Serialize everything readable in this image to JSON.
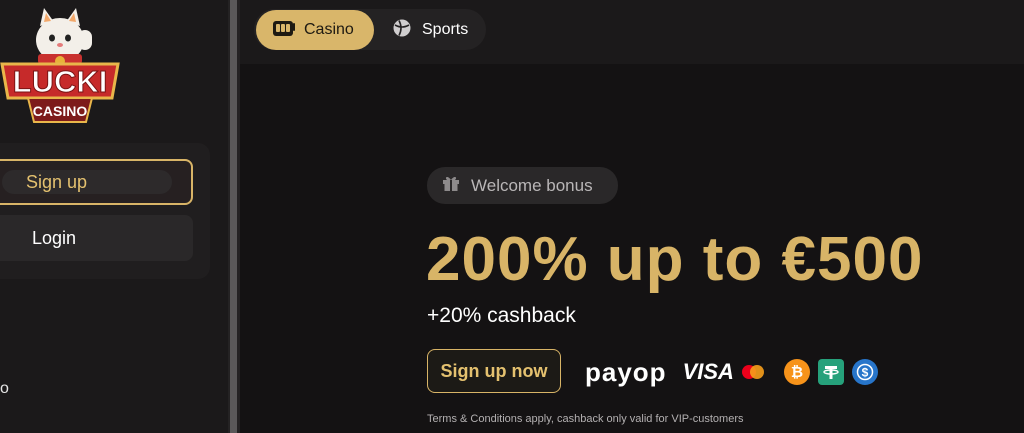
{
  "brand": {
    "logo_text": "LUCKI",
    "logo_subtext": "CASINO"
  },
  "sidebar": {
    "signup_label": "Sign up",
    "login_label": "Login",
    "partial_item": "o"
  },
  "topbar": {
    "tabs": [
      {
        "label": "Casino",
        "icon": "casino-slot-icon",
        "active": true
      },
      {
        "label": "Sports",
        "icon": "ball-icon",
        "active": false
      }
    ]
  },
  "hero": {
    "badge_label": "Welcome bonus",
    "badge_icon": "gift-icon",
    "headline": "200% up to €500",
    "subline": "+20% cashback",
    "cta_label": "Sign up now",
    "terms": "Terms & Conditions apply, cashback only valid for VIP-customers"
  },
  "payments": {
    "payop": "payop",
    "visa": "VISA",
    "methods": [
      "mastercard-icon",
      "bitcoin-icon",
      "tether-icon",
      "usdc-icon"
    ]
  },
  "colors": {
    "gold": "#d8b467",
    "background": "#141213",
    "sidebar": "#1b191a"
  }
}
